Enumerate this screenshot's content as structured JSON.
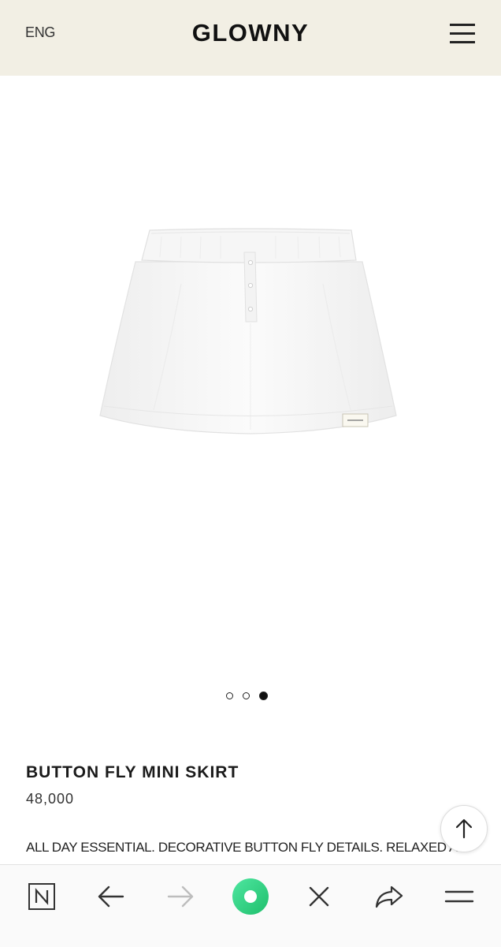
{
  "header": {
    "language": "ENG",
    "brand": "GLOWNY",
    "background_color": "#f2efe4"
  },
  "gallery": {
    "image_alt": "white button fly mini skirt",
    "label_text": "GLOWNY",
    "slide_count": 3,
    "active_index": 2
  },
  "product": {
    "name": "BUTTON FLY MINI SKIRT",
    "price": "48,000",
    "description": "ALL DAY ESSENTIAL. DECORATIVE BUTTON FLY DETAILS. RELAXED A LINE FIT. CLASSIC LOGO LABEL ON THE HEM LINE. COMFY COTTON"
  },
  "browser_toolbar": {
    "home_icon": "naver-n-icon",
    "back_icon": "arrow-left-icon",
    "forward_icon": "arrow-right-icon",
    "center_icon": "green-ring-icon",
    "close_icon": "close-icon",
    "share_icon": "share-icon",
    "menu_icon": "menu-icon",
    "accent_color": "#2ecc71"
  }
}
